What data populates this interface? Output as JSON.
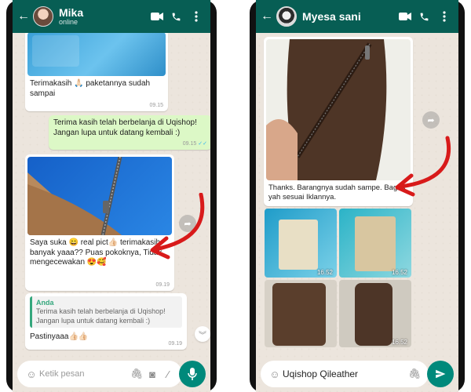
{
  "colors": {
    "header": "#075e54",
    "outgoing_bubble": "#dcf8c6",
    "incoming_bubble": "#ffffff",
    "fab": "#00897b",
    "read_ticks": "#34b7f1",
    "annotation_arrow": "#d81a1a"
  },
  "left_chat": {
    "contact_name": "Mika",
    "status": "online",
    "messages": [
      {
        "text": "Terimakasih 🙏🏻 paketannya sudah sampai",
        "time": "09.15"
      },
      {
        "text": "Terima kasih telah berbelanja di Uqishop! Jangan lupa untuk datang kembali :)",
        "time": "09.15",
        "ticks": "✓✓"
      },
      {
        "text": "Saya suka 😄 real pict👍🏻 terimakasih banyak yaaa?? Puas pokoknya, Tidak mengecewakan 😍🥰",
        "time": "09.19"
      },
      {
        "quote_name": "Anda",
        "quote_text": "Terima kasih telah berbelanja di Uqishop! Jangan lupa untuk datang kembali :)",
        "text": "Pastinyaaa👍🏻👍🏻",
        "time": "09.19"
      }
    ],
    "input_placeholder": "Ketik pesan",
    "icons": [
      "back-arrow-icon",
      "avatar",
      "video-call-icon",
      "phone-icon",
      "more-icon",
      "emoji-icon",
      "attach-icon",
      "camera-icon",
      "stylus-icon",
      "mic-icon",
      "forward-icon",
      "scroll-down-icon"
    ]
  },
  "right_chat": {
    "contact_name": "Myesa sani",
    "messages": [
      {
        "text": "Thanks. Barangnya sudah sampe. Bagus yah sesuai Iklannya."
      },
      {
        "photo_times": [
          "16.52",
          "16.52",
          "",
          "16.52"
        ]
      }
    ],
    "input_value": "Uqishop Qileather",
    "icons": [
      "back-arrow-icon",
      "avatar",
      "video-call-icon",
      "phone-icon",
      "more-icon",
      "emoji-icon",
      "attach-icon",
      "send-icon",
      "forward-icon"
    ]
  }
}
